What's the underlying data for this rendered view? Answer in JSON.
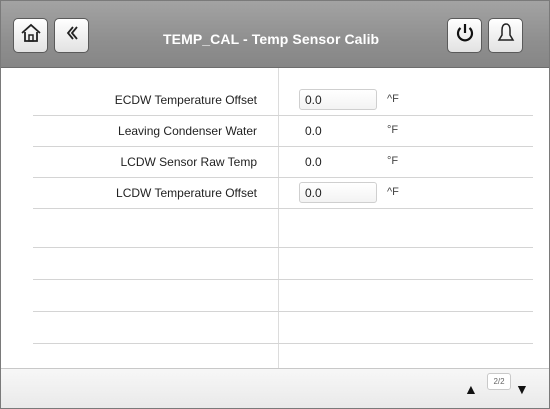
{
  "header": {
    "title": "TEMP_CAL - Temp Sensor Calib",
    "home_icon": "home-icon",
    "back_icon": "chevron-left-icon",
    "power_icon": "power-icon",
    "alarm_icon": "bell-icon"
  },
  "rows": [
    {
      "label": "ECDW Temperature Offset",
      "value": "0.0",
      "unit": "^F",
      "editable": true
    },
    {
      "label": "Leaving Condenser Water",
      "value": "0.0",
      "unit": "°F",
      "editable": false
    },
    {
      "label": "LCDW Sensor Raw Temp",
      "value": "0.0",
      "unit": "°F",
      "editable": false
    },
    {
      "label": "LCDW Temperature Offset",
      "value": "0.0",
      "unit": "^F",
      "editable": true
    }
  ],
  "footer": {
    "page_indicator": "2/2",
    "up_arrow": "▲",
    "down_arrow": "▼"
  },
  "colors": {
    "header_bg": "#969696",
    "title_text": "#ffffff",
    "row_divider": "#d4d4d4"
  }
}
